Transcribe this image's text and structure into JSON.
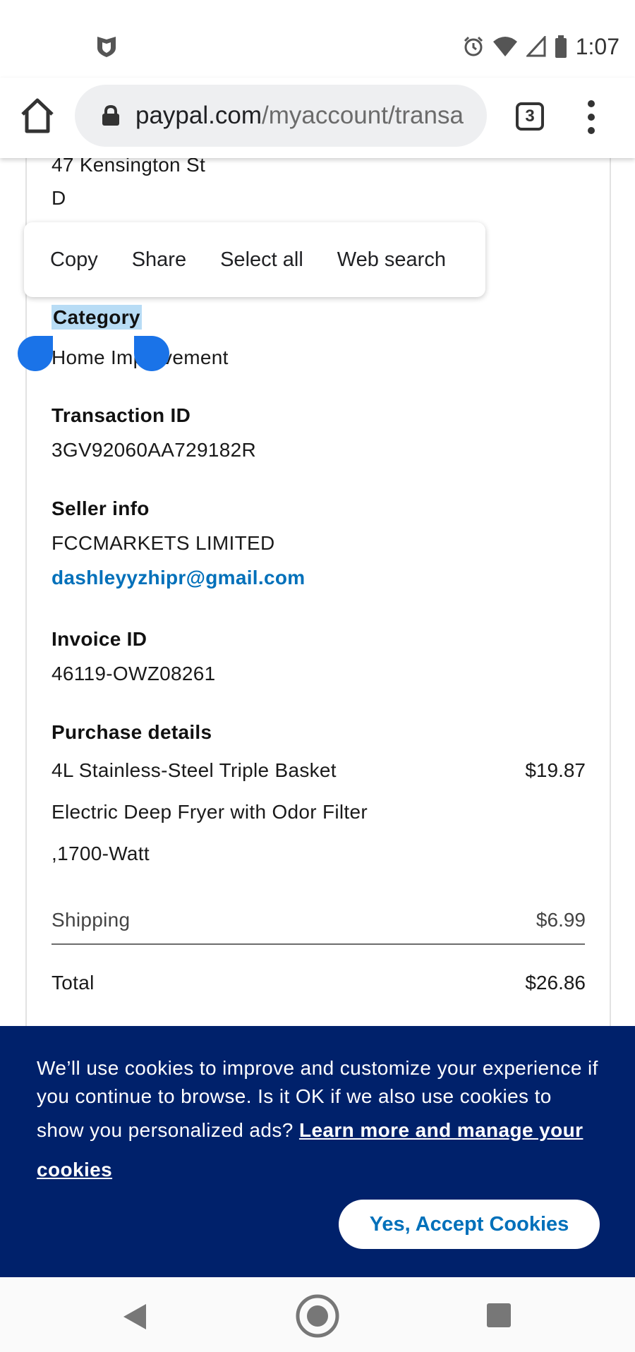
{
  "status_bar": {
    "time": "1:07",
    "icons": [
      "shield-icon",
      "alarm-icon",
      "wifi-icon",
      "signal-icon",
      "battery-icon"
    ]
  },
  "browser": {
    "url_domain": "paypal.com",
    "url_path": "/myaccount/transa",
    "tab_count": "3",
    "icons": [
      "home-icon",
      "lock-icon",
      "menu-icon"
    ]
  },
  "address": {
    "line1": "47 Kensington St",
    "line2": "D"
  },
  "context_menu": {
    "items": [
      "Copy",
      "Share",
      "Select all",
      "Web search"
    ]
  },
  "category": {
    "label": "Category",
    "value": "Home Improvement"
  },
  "transaction": {
    "label": "Transaction ID",
    "value": "3GV92060AA729182R"
  },
  "seller": {
    "label": "Seller info",
    "name": "FCCMARKETS LIMITED",
    "email": "dashleyyzhipr@gmail.com"
  },
  "invoice": {
    "label": "Invoice ID",
    "value": "46119-OWZ08261"
  },
  "purchase": {
    "label": "Purchase details",
    "item_lines": [
      "4L Stainless-Steel Triple Basket",
      "Electric Deep Fryer with Odor Filter",
      ",1700-Watt"
    ],
    "item_amount": "$19.87",
    "shipping_label": "Shipping",
    "shipping_amount": "$6.99",
    "total_label": "Total",
    "total_amount": "$26.86"
  },
  "cookie_banner": {
    "text": "We’ll use cookies to improve and customize your experience if you continue to browse. Is it OK if we also use cookies to show you personalized ads?",
    "link": "Learn more and manage your cookies",
    "accept_label": "Yes, Accept Cookies",
    "background": "#00216b",
    "accent": "#0070ba"
  },
  "nav": {
    "icons": [
      "back-icon",
      "home-circle-icon",
      "recents-icon"
    ]
  }
}
